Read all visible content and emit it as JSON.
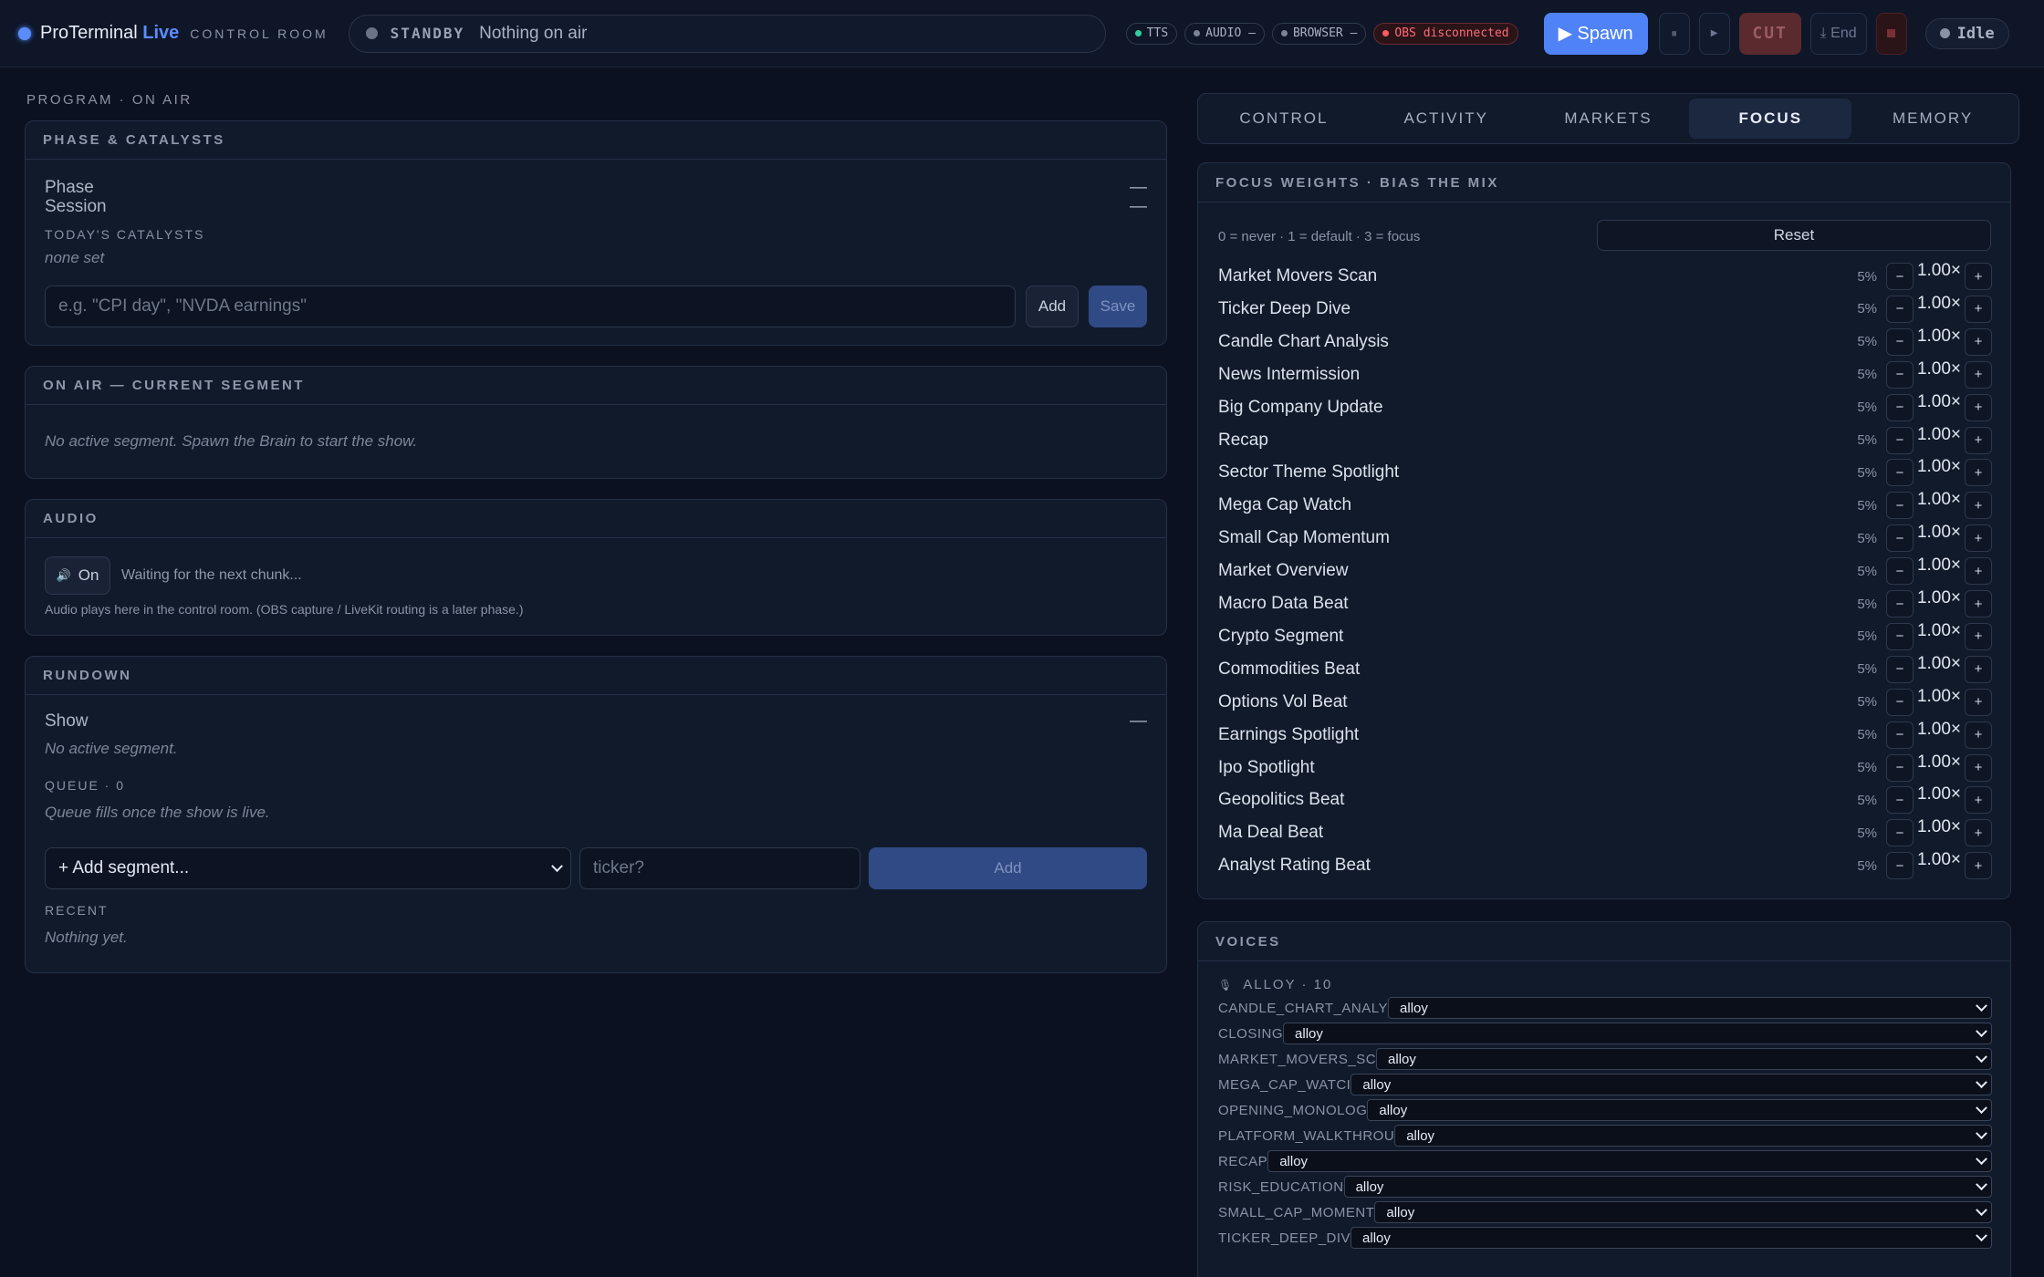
{
  "topbar": {
    "brand": "ProTerminal",
    "brand_live": "Live",
    "brand_sub": "CONTROL ROOM",
    "standby_label": "STANDBY",
    "standby_text": "Nothing on air",
    "pills": [
      {
        "label": "TTS",
        "color": "#2fd0a0"
      },
      {
        "label": "AUDIO —",
        "color": "#7b8496"
      },
      {
        "label": "BROWSER —",
        "color": "#7b8496"
      },
      {
        "label": "OBS disconnected",
        "color": "#ff5a66"
      }
    ],
    "spawn_label": "▶ Spawn",
    "pause_icon": "⏸",
    "play_icon": "▶",
    "cut_label": "CUT",
    "end_label": "⤓ End",
    "status_label": "Idle"
  },
  "left": {
    "section_label": "PROGRAM · ON AIR",
    "phase_card": {
      "title": "PHASE & CATALYSTS",
      "phase_label": "Phase",
      "phase_value": "—",
      "session_label": "Session",
      "session_value": "—",
      "catalysts_label": "TODAY'S CATALYSTS",
      "catalysts_empty": "none set",
      "input_placeholder": "e.g. \"CPI day\", \"NVDA earnings\"",
      "add_label": "Add",
      "save_label": "Save"
    },
    "onair_card": {
      "title": "ON AIR — CURRENT SEGMENT",
      "empty_text": "No active segment. Spawn the Brain to start the show."
    },
    "audio_card": {
      "title": "AUDIO",
      "toggle_icon": "🔊",
      "toggle_label": "On",
      "status_text": "Waiting for the next chunk...",
      "note": "Audio plays here in the control room. (OBS capture / LiveKit routing is a later phase.)"
    },
    "rundown_card": {
      "title": "RUNDOWN",
      "show_label": "Show",
      "show_value": "—",
      "show_empty": "No active segment.",
      "queue_label": "QUEUE · 0",
      "queue_empty": "Queue fills once the show is live.",
      "add_segment_label": "+ Add segment...",
      "ticker_placeholder": "ticker?",
      "add_label": "Add",
      "recent_label": "RECENT",
      "recent_empty": "Nothing yet."
    }
  },
  "right": {
    "tabs": [
      "CONTROL",
      "ACTIVITY",
      "MARKETS",
      "FOCUS",
      "MEMORY"
    ],
    "active_tab": "FOCUS",
    "focus_card": {
      "title": "FOCUS WEIGHTS · BIAS THE MIX",
      "legend": "0 = never · 1 = default · 3 = focus",
      "reset_label": "Reset",
      "minus": "−",
      "plus": "+",
      "weights": [
        {
          "name": "Market Movers Scan",
          "pct": "5%",
          "value": "1.00×"
        },
        {
          "name": "Ticker Deep Dive",
          "pct": "5%",
          "value": "1.00×"
        },
        {
          "name": "Candle Chart Analysis",
          "pct": "5%",
          "value": "1.00×"
        },
        {
          "name": "News Intermission",
          "pct": "5%",
          "value": "1.00×"
        },
        {
          "name": "Big Company Update",
          "pct": "5%",
          "value": "1.00×"
        },
        {
          "name": "Recap",
          "pct": "5%",
          "value": "1.00×"
        },
        {
          "name": "Sector Theme Spotlight",
          "pct": "5%",
          "value": "1.00×"
        },
        {
          "name": "Mega Cap Watch",
          "pct": "5%",
          "value": "1.00×"
        },
        {
          "name": "Small Cap Momentum",
          "pct": "5%",
          "value": "1.00×"
        },
        {
          "name": "Market Overview",
          "pct": "5%",
          "value": "1.00×"
        },
        {
          "name": "Macro Data Beat",
          "pct": "5%",
          "value": "1.00×"
        },
        {
          "name": "Crypto Segment",
          "pct": "5%",
          "value": "1.00×"
        },
        {
          "name": "Commodities Beat",
          "pct": "5%",
          "value": "1.00×"
        },
        {
          "name": "Options Vol Beat",
          "pct": "5%",
          "value": "1.00×"
        },
        {
          "name": "Earnings Spotlight",
          "pct": "5%",
          "value": "1.00×"
        },
        {
          "name": "Ipo Spotlight",
          "pct": "5%",
          "value": "1.00×"
        },
        {
          "name": "Geopolitics Beat",
          "pct": "5%",
          "value": "1.00×"
        },
        {
          "name": "Ma Deal Beat",
          "pct": "5%",
          "value": "1.00×"
        },
        {
          "name": "Analyst Rating Beat",
          "pct": "5%",
          "value": "1.00×"
        }
      ]
    },
    "voices_card": {
      "title": "VOICES",
      "group_icon": "🎙",
      "group_label": "ALLOY · 10",
      "voices": [
        {
          "name": "CANDLE_CHART_ANALY",
          "value": "alloy"
        },
        {
          "name": "CLOSING",
          "value": "alloy"
        },
        {
          "name": "MARKET_MOVERS_SC",
          "value": "alloy"
        },
        {
          "name": "MEGA_CAP_WATCI",
          "value": "alloy"
        },
        {
          "name": "OPENING_MONOLOG",
          "value": "alloy"
        },
        {
          "name": "PLATFORM_WALKTHROU",
          "value": "alloy"
        },
        {
          "name": "RECAP",
          "value": "alloy"
        },
        {
          "name": "RISK_EDUCATION",
          "value": "alloy"
        },
        {
          "name": "SMALL_CAP_MOMENT",
          "value": "alloy"
        },
        {
          "name": "TICKER_DEEP_DIV",
          "value": "alloy"
        }
      ]
    }
  }
}
